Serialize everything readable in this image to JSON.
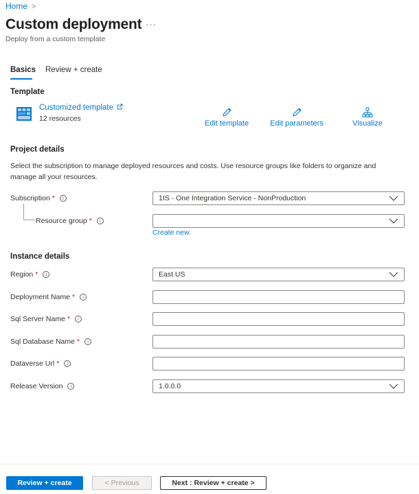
{
  "breadcrumb": {
    "home": "Home",
    "separator": ">"
  },
  "header": {
    "title": "Custom deployment",
    "more": "···",
    "subtitle": "Deploy from a custom template"
  },
  "tabs": [
    {
      "label": "Basics",
      "active": true
    },
    {
      "label": "Review + create",
      "active": false
    }
  ],
  "template": {
    "section_title": "Template",
    "name": "Customized template",
    "resources": "12 resources",
    "actions": {
      "edit_template": "Edit template",
      "edit_parameters": "Edit parameters",
      "visualize": "Visualize"
    }
  },
  "project": {
    "section_title": "Project details",
    "description": "Select the subscription to manage deployed resources and costs. Use resource groups like folders to organize and manage all your resources.",
    "subscription": {
      "label": "Subscription",
      "value": "1IS - One Integration Service - NonProduction"
    },
    "resource_group": {
      "label": "Resource group",
      "value": "",
      "create_new": "Create new"
    }
  },
  "instance": {
    "section_title": "Instance details",
    "region": {
      "label": "Region",
      "value": "East US"
    },
    "deployment_name": {
      "label": "Deployment Name",
      "value": ""
    },
    "sql_server_name": {
      "label": "Sql Server Name",
      "value": ""
    },
    "sql_database_name": {
      "label": "Sql Database Name",
      "value": ""
    },
    "dataverse_url": {
      "label": "Dataverse Url",
      "value": ""
    },
    "release_version": {
      "label": "Release Version",
      "value": "1.0.0.0"
    }
  },
  "required_mark": "*",
  "info_glyph": "i",
  "footer": {
    "review_create": "Review + create",
    "previous": "< Previous",
    "next": "Next : Review + create >"
  },
  "colors": {
    "accent": "#0078d4",
    "required": "#a4262c"
  }
}
